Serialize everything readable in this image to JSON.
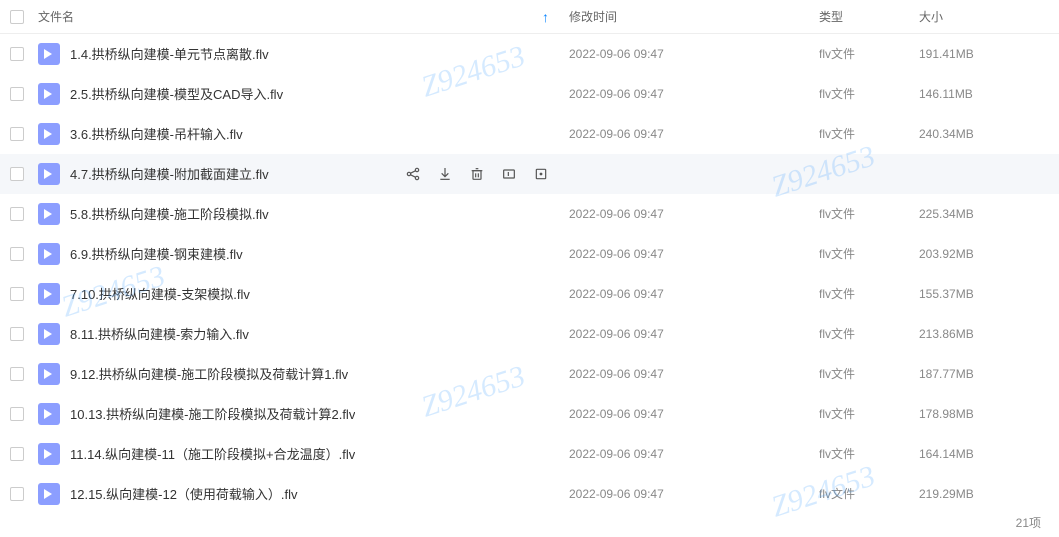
{
  "header": {
    "name_label": "文件名",
    "time_label": "修改时间",
    "type_label": "类型",
    "size_label": "大小"
  },
  "files": [
    {
      "name": "1.4.拱桥纵向建模-单元节点离散.flv",
      "time": "2022-09-06 09:47",
      "type": "flv文件",
      "size": "191.41MB",
      "hovered": false
    },
    {
      "name": "2.5.拱桥纵向建模-模型及CAD导入.flv",
      "time": "2022-09-06 09:47",
      "type": "flv文件",
      "size": "146.11MB",
      "hovered": false
    },
    {
      "name": "3.6.拱桥纵向建模-吊杆输入.flv",
      "time": "2022-09-06 09:47",
      "type": "flv文件",
      "size": "240.34MB",
      "hovered": false
    },
    {
      "name": "4.7.拱桥纵向建模-附加截面建立.flv",
      "time": "",
      "type": "",
      "size": "",
      "hovered": true
    },
    {
      "name": "5.8.拱桥纵向建模-施工阶段模拟.flv",
      "time": "2022-09-06 09:47",
      "type": "flv文件",
      "size": "225.34MB",
      "hovered": false
    },
    {
      "name": "6.9.拱桥纵向建模-钢束建模.flv",
      "time": "2022-09-06 09:47",
      "type": "flv文件",
      "size": "203.92MB",
      "hovered": false
    },
    {
      "name": "7.10.拱桥纵向建模-支架模拟.flv",
      "time": "2022-09-06 09:47",
      "type": "flv文件",
      "size": "155.37MB",
      "hovered": false
    },
    {
      "name": "8.11.拱桥纵向建模-索力输入.flv",
      "time": "2022-09-06 09:47",
      "type": "flv文件",
      "size": "213.86MB",
      "hovered": false
    },
    {
      "name": "9.12.拱桥纵向建模-施工阶段模拟及荷载计算1.flv",
      "time": "2022-09-06 09:47",
      "type": "flv文件",
      "size": "187.77MB",
      "hovered": false
    },
    {
      "name": "10.13.拱桥纵向建模-施工阶段模拟及荷载计算2.flv",
      "time": "2022-09-06 09:47",
      "type": "flv文件",
      "size": "178.98MB",
      "hovered": false
    },
    {
      "name": "11.14.纵向建模-11（施工阶段模拟+合龙温度）.flv",
      "time": "2022-09-06 09:47",
      "type": "flv文件",
      "size": "164.14MB",
      "hovered": false
    },
    {
      "name": "12.15.纵向建模-12（使用荷载输入）.flv",
      "time": "2022-09-06 09:47",
      "type": "flv文件",
      "size": "219.29MB",
      "hovered": false
    }
  ],
  "footer": {
    "count_label": "21项"
  },
  "watermark": "Z924653"
}
